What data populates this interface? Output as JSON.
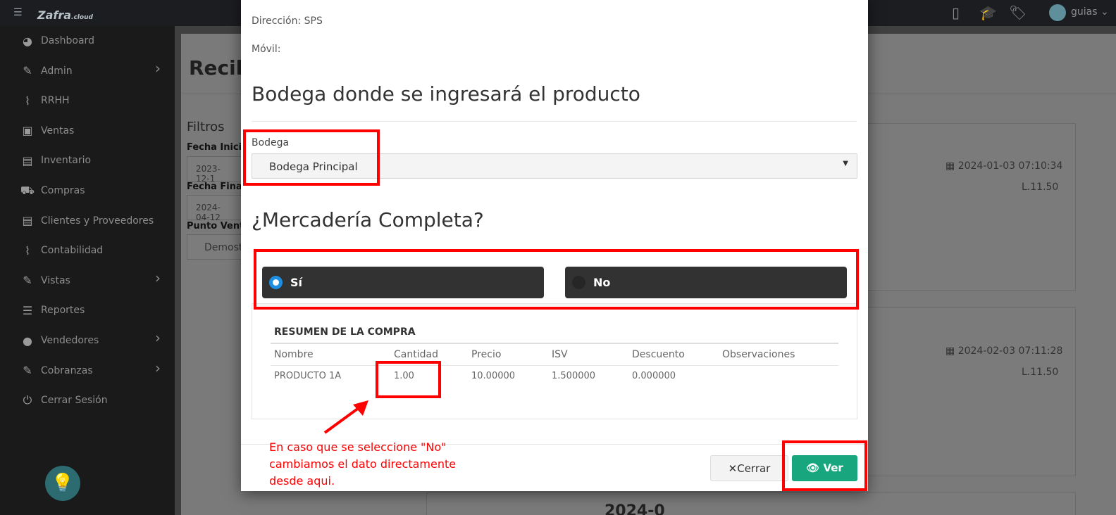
{
  "app": {
    "logo": "Zafra",
    "logo_suffix": ".cloud",
    "user": "guias ⌄"
  },
  "sidebar": {
    "items": [
      {
        "label": "Dashboard",
        "icon": "palette-icon",
        "glyph": "◕",
        "arrow": false
      },
      {
        "label": "Admin",
        "icon": "wrench-icon",
        "glyph": "✎",
        "arrow": true
      },
      {
        "label": "RRHH",
        "icon": "paperclip-icon",
        "glyph": "⌇",
        "arrow": false
      },
      {
        "label": "Ventas",
        "icon": "money-icon",
        "glyph": "▣",
        "arrow": false
      },
      {
        "label": "Inventario",
        "icon": "book-icon",
        "glyph": "▤",
        "arrow": false
      },
      {
        "label": "Compras",
        "icon": "cart-icon",
        "glyph": "⛟",
        "arrow": false
      },
      {
        "label": "Clientes y Proveedores",
        "icon": "book-icon",
        "glyph": "▤",
        "arrow": false
      },
      {
        "label": "Contabilidad",
        "icon": "paperclip-icon",
        "glyph": "⌇",
        "arrow": false
      },
      {
        "label": "Vistas",
        "icon": "edit-icon",
        "glyph": "✎",
        "arrow": true
      },
      {
        "label": "Reportes",
        "icon": "list-icon",
        "glyph": "☰",
        "arrow": false
      },
      {
        "label": "Vendedores",
        "icon": "user-icon",
        "glyph": "●",
        "arrow": true
      },
      {
        "label": "Cobranzas",
        "icon": "edit-icon",
        "glyph": "✎",
        "arrow": true
      },
      {
        "label": "Cerrar Sesión",
        "icon": "power-icon",
        "glyph": "⏻",
        "arrow": false
      }
    ]
  },
  "background": {
    "page_title": "Recibi",
    "filters_title": "Filtros",
    "fecha_inicio_label": "Fecha Inicio",
    "fecha_inicio_value": "2023-12-1",
    "fecha_final_label": "Fecha Final",
    "fecha_final_value": "2024-04-12",
    "punto_venta_label": "Punto Vent",
    "punto_venta_value": "Demost",
    "card1_date": "2024-01-03 07:10:34",
    "card1_price": "L.11.50",
    "card2_date": "2024-02-03 07:11:28",
    "card2_price": "L.11.50",
    "bottom_text": "2024-0"
  },
  "modal": {
    "direccion": "Dirección: SPS",
    "movil": "Móvil:",
    "bodega_heading": "Bodega donde se ingresará el producto",
    "bodega_label": "Bodega",
    "bodega_selected": "Bodega Principal",
    "mercaderia_heading": "¿Mercadería Completa?",
    "radio_yes": "Sí",
    "radio_no": "No",
    "radio_selected": "yes",
    "summary_title": "RESUMEN DE LA COMPRA",
    "table": {
      "headers": [
        "Nombre",
        "Cantidad",
        "Precio",
        "ISV",
        "Descuento",
        "Observaciones"
      ],
      "rows": [
        [
          "PRODUCTO 1A",
          "1.00",
          "10.00000",
          "1.500000",
          "0.000000",
          ""
        ]
      ]
    },
    "close_button": "Cerrar",
    "ver_button": "Ver"
  },
  "annotation": {
    "note": "En caso que se seleccione \"No\" cambiamos el dato directamente desde aqui.",
    "color": "#ff0000"
  },
  "colors": {
    "accent_green": "#18a67f",
    "radio_blue": "#1e8fe0",
    "dark_card": "#323232"
  }
}
